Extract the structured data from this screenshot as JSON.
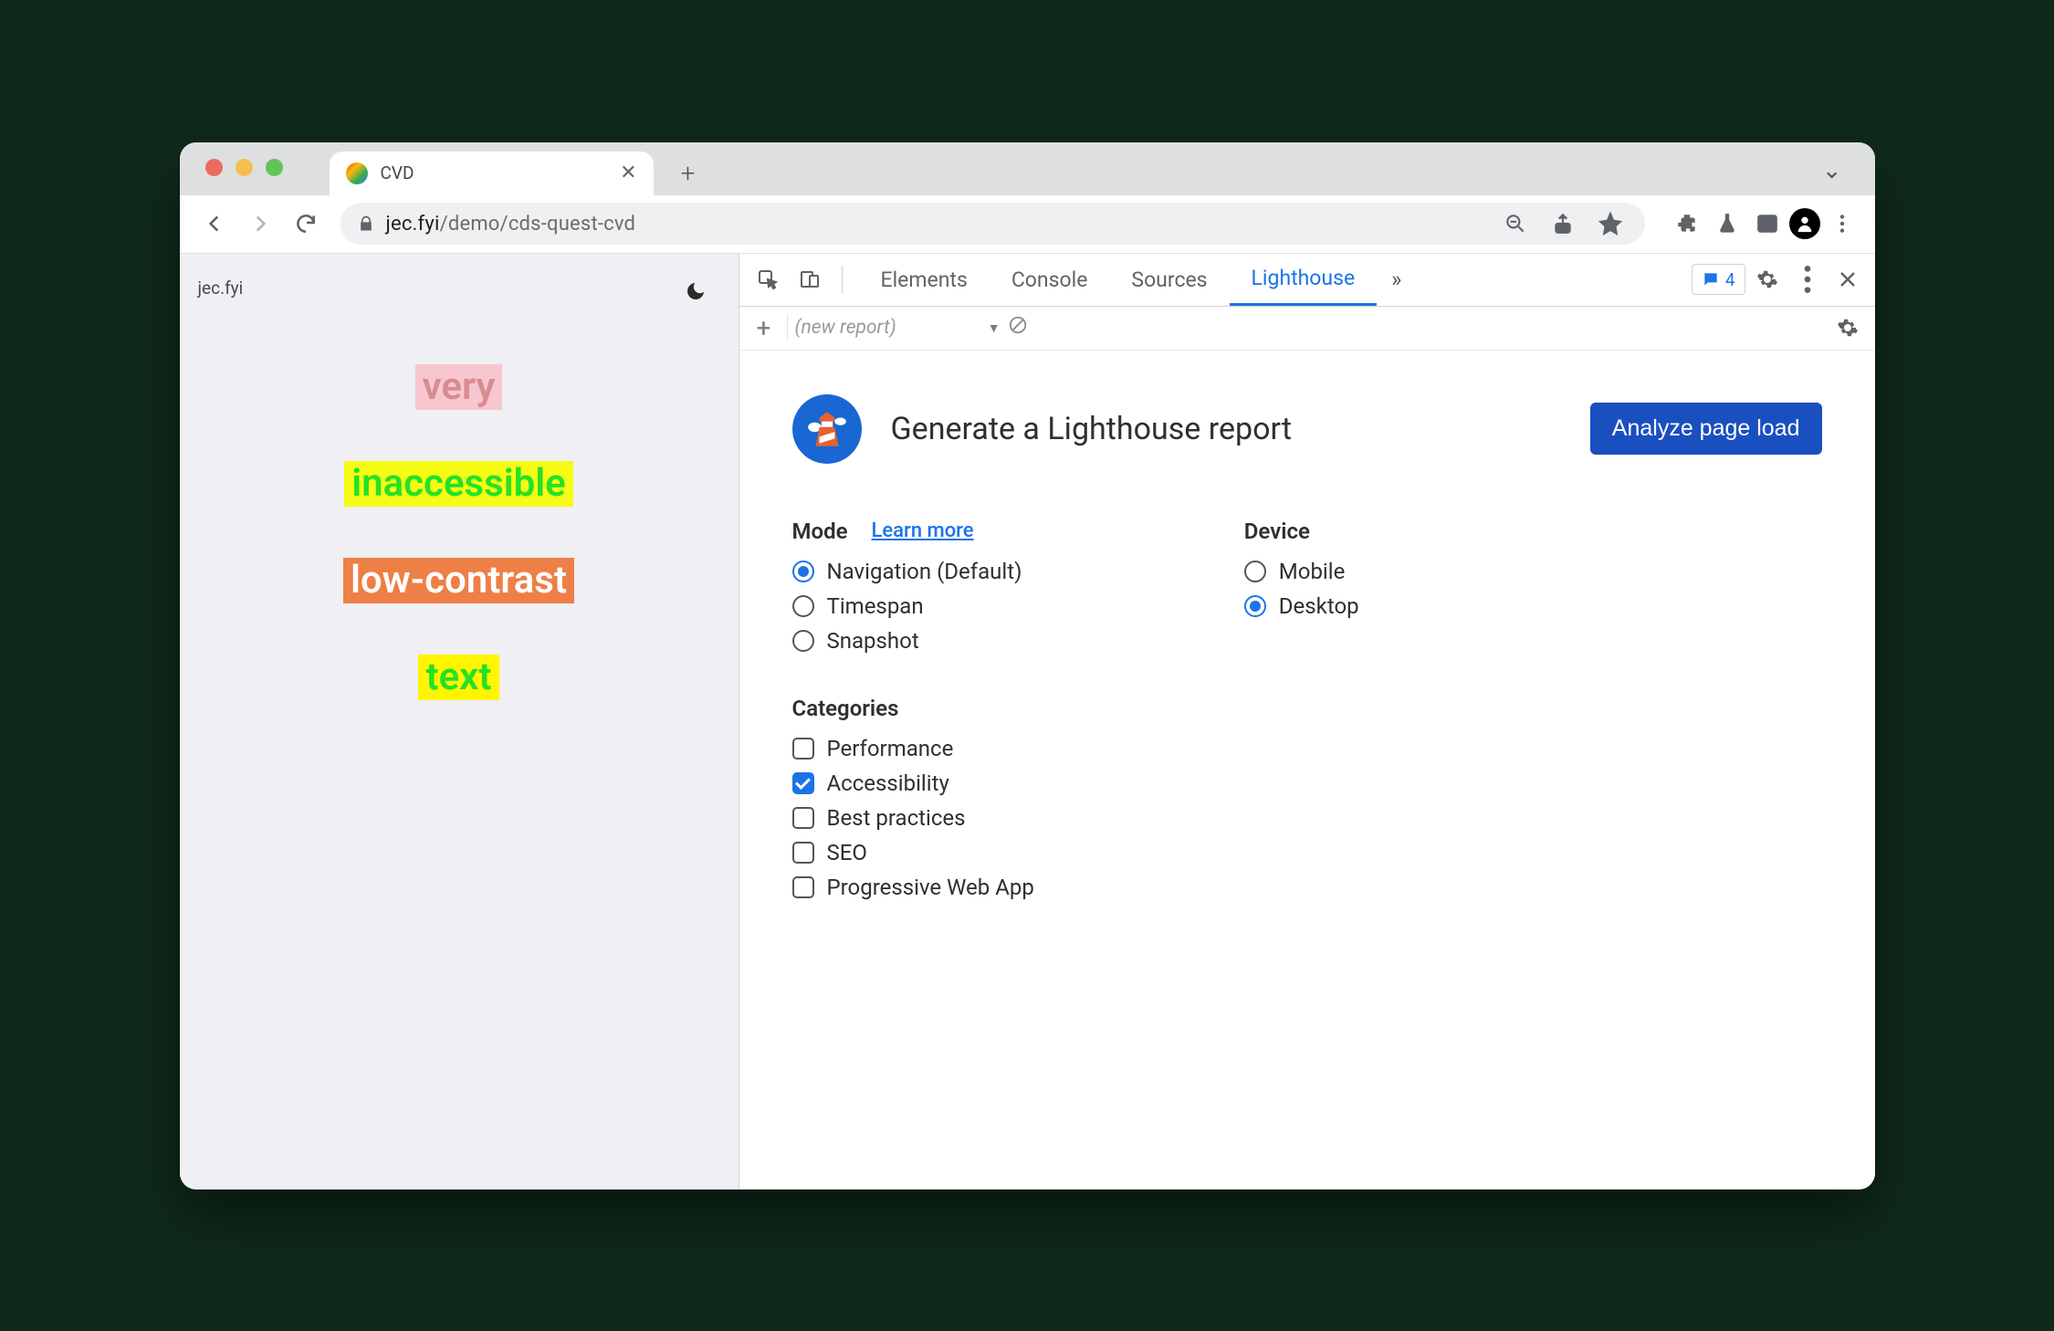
{
  "tab": {
    "title": "CVD"
  },
  "url": {
    "host": "jec.fyi",
    "path": "/demo/cds-quest-cvd"
  },
  "page": {
    "brand": "jec.fyi",
    "words": [
      "very",
      "inaccessible",
      "low-contrast",
      "text"
    ]
  },
  "devtools": {
    "tabs": [
      "Elements",
      "Console",
      "Sources",
      "Lighthouse"
    ],
    "active_tab": "Lighthouse",
    "issues_count": "4"
  },
  "lighthouse": {
    "toolbar": {
      "report_label": "(new report)"
    },
    "title": "Generate a Lighthouse report",
    "cta": "Analyze page load",
    "mode": {
      "heading": "Mode",
      "learn_more": "Learn more",
      "options": [
        {
          "label": "Navigation (Default)",
          "checked": true
        },
        {
          "label": "Timespan",
          "checked": false
        },
        {
          "label": "Snapshot",
          "checked": false
        }
      ]
    },
    "device": {
      "heading": "Device",
      "options": [
        {
          "label": "Mobile",
          "checked": false
        },
        {
          "label": "Desktop",
          "checked": true
        }
      ]
    },
    "categories": {
      "heading": "Categories",
      "options": [
        {
          "label": "Performance",
          "checked": false
        },
        {
          "label": "Accessibility",
          "checked": true
        },
        {
          "label": "Best practices",
          "checked": false
        },
        {
          "label": "SEO",
          "checked": false
        },
        {
          "label": "Progressive Web App",
          "checked": false
        }
      ]
    }
  }
}
